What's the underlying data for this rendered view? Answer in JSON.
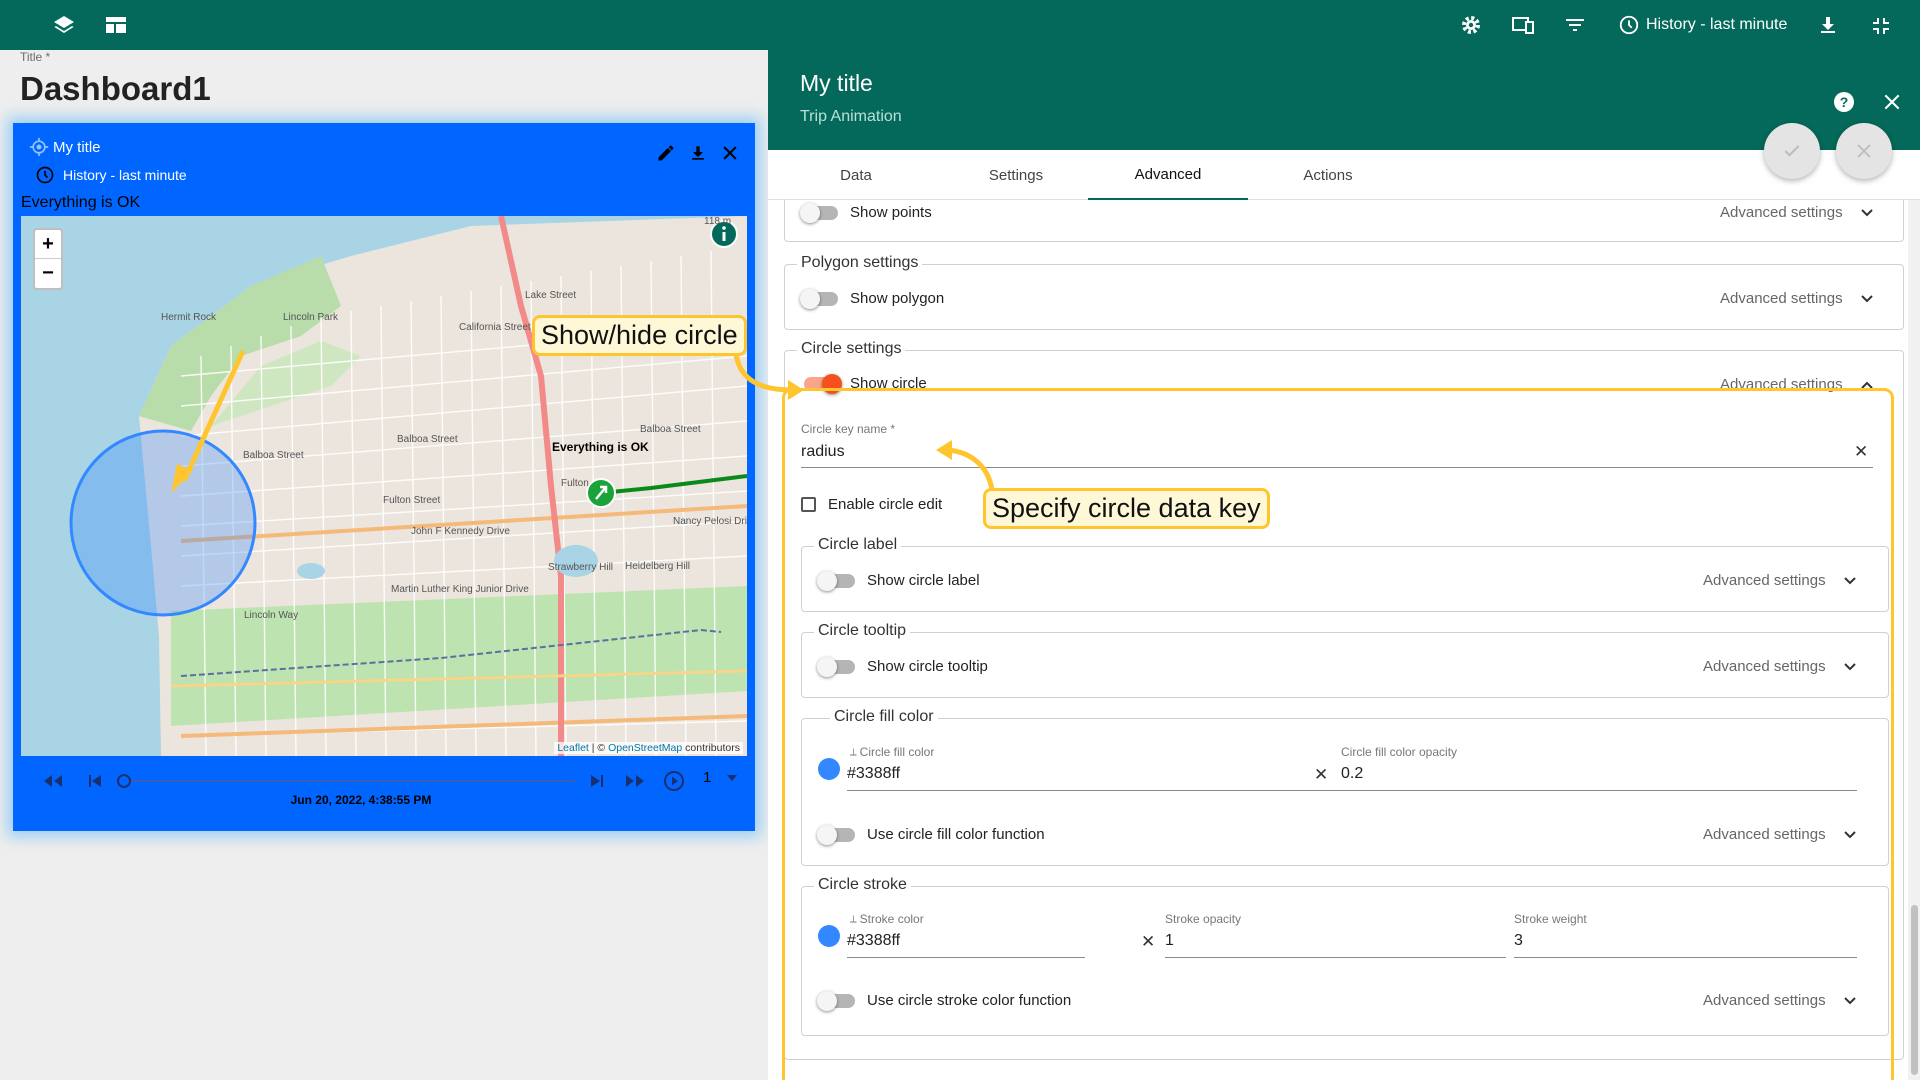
{
  "topbar": {
    "history_label": "History - last minute",
    "icons": [
      "layers-icon",
      "dashboard-layout-icon",
      "settings-icon",
      "devices-icon",
      "filter-icon",
      "clock-icon",
      "download-icon",
      "fullscreen-exit-icon"
    ]
  },
  "dashboard": {
    "title_label": "Title *",
    "name": "Dashboard1"
  },
  "widget": {
    "title": "My title",
    "history": "History - last minute",
    "status": "Everything is OK",
    "map": {
      "status_label": "Everything is OK",
      "attribution_leaflet": "Leaflet",
      "attribution_sep": " | © ",
      "attribution_osm": "OpenStreetMap",
      "attribution_tail": " contributors",
      "zoom_in": "+",
      "zoom_out": "−",
      "street_labels": [
        "Lake Street",
        "California Street",
        "Balboa Street",
        "Balboa Street",
        "Balboa Street",
        "Fulton Street",
        "John F Kennedy Drive",
        "Martin Luther King Junior Drive",
        "Lincoln Way",
        "Lincoln Park",
        "Hermit Rock",
        "Strawberry Hill",
        "Heidelberg Hill",
        "Nancy Pelosi Drive",
        "Fulton"
      ],
      "scale_label": "118 m",
      "circle_color": "#3388ff"
    },
    "timestamp": "Jun 20, 2022, 4:38:55 PM",
    "speed": "1",
    "progress": 0.0
  },
  "callouts": {
    "show_hide": "Show/hide circle",
    "specify_key": "Specify circle data key"
  },
  "panel": {
    "title": "My title",
    "subtitle": "Trip Animation",
    "tabs": [
      {
        "label": "Data"
      },
      {
        "label": "Settings"
      },
      {
        "label": "Advanced"
      },
      {
        "label": "Actions"
      }
    ],
    "active_tab": "Advanced",
    "advanced_label": "Advanced settings",
    "show_points": "Show points",
    "polygon_settings": "Polygon settings",
    "show_polygon": "Show polygon",
    "circle_settings": "Circle settings",
    "show_circle": "Show circle",
    "circle_key_label": "Circle key name *",
    "circle_key_value": "radius",
    "enable_circle_edit": "Enable circle edit",
    "circle_label_legend": "Circle label",
    "show_circle_label": "Show circle label",
    "circle_tooltip_legend": "Circle tooltip",
    "show_circle_tooltip": "Show circle tooltip",
    "circle_fill_legend": "Circle fill color",
    "fill_color_label": "Circle fill color",
    "fill_color_value": "#3388ff",
    "fill_opacity_label": "Circle fill color opacity",
    "fill_opacity_value": "0.2",
    "use_fill_function": "Use circle fill color function",
    "circle_stroke_legend": "Circle stroke",
    "stroke_color_label": "Stroke color",
    "stroke_color_value": "#3388ff",
    "stroke_opacity_label": "Stroke opacity",
    "stroke_opacity_value": "1",
    "stroke_weight_label": "Stroke weight",
    "stroke_weight_value": "3",
    "use_stroke_function": "Use circle stroke color function"
  },
  "colors": {
    "header": "#04695a",
    "widget_bg": "#0066ff",
    "toggle_on": "#f4511e",
    "highlight": "#ffc52e"
  }
}
